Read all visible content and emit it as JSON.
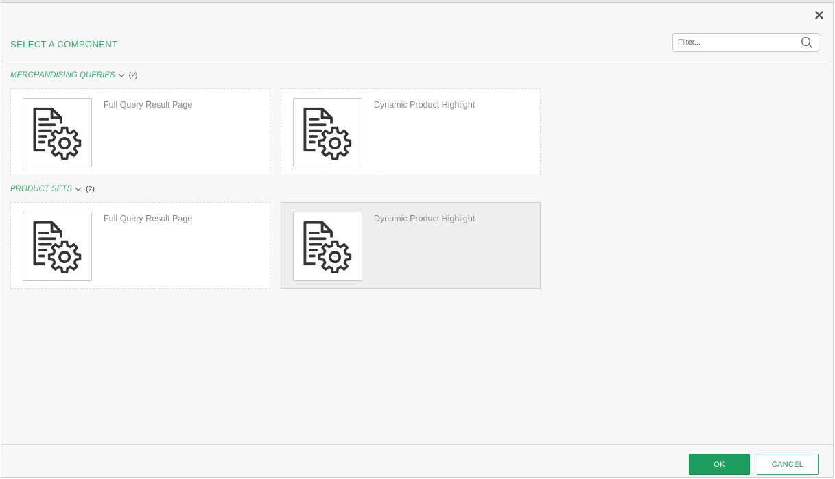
{
  "dialog": {
    "title": "SELECT A COMPONENT",
    "close_icon": "close-icon",
    "filter": {
      "placeholder": "Filter...",
      "value": "",
      "icon": "search-icon"
    }
  },
  "groups": [
    {
      "label": "MERCHANDISING QUERIES",
      "count": "(2)",
      "items": [
        {
          "title": "Full Query Result Page",
          "icon": "document-gear-icon"
        },
        {
          "title": "Dynamic Product Highlight",
          "icon": "document-gear-icon"
        }
      ]
    },
    {
      "label": "PRODUCT SETS",
      "count": "(2)",
      "items": [
        {
          "title": "Full Query Result Page",
          "icon": "document-gear-icon"
        },
        {
          "title": "Dynamic Product Highlight",
          "icon": "document-gear-icon",
          "selected": true
        }
      ]
    }
  ],
  "footer": {
    "ok_label": "OK",
    "cancel_label": "CANCEL"
  },
  "colors": {
    "accent": "#3aa76d",
    "ok_button": "#1f9d5e",
    "selected_card": "#eeeeee"
  }
}
